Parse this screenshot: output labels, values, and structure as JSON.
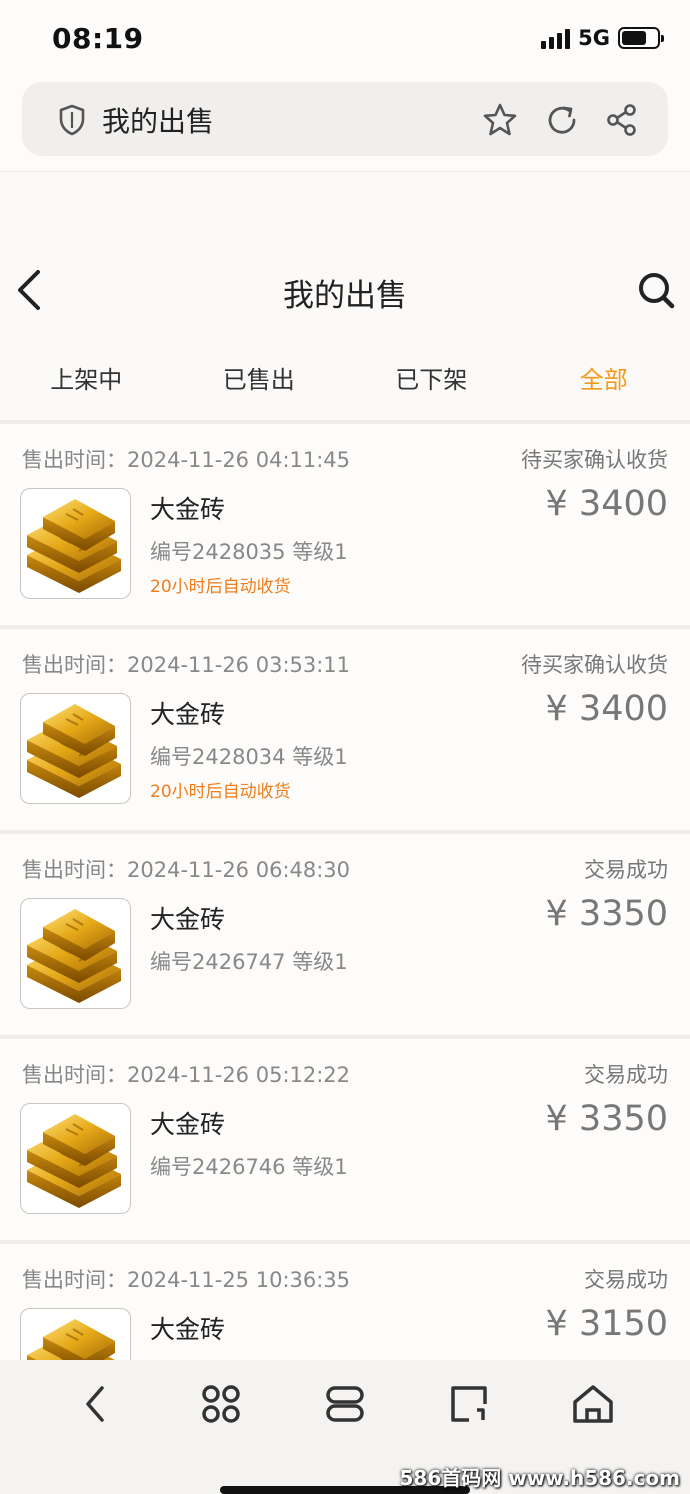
{
  "status_bar": {
    "time": "08:19",
    "network": "5G",
    "battery_level": 0.7
  },
  "browser": {
    "title": "我的出售"
  },
  "nav": {
    "title": "我的出售"
  },
  "tabs": [
    {
      "label": "上架中",
      "active": false
    },
    {
      "label": "已售出",
      "active": false
    },
    {
      "label": "已下架",
      "active": false
    },
    {
      "label": "全部",
      "active": true
    }
  ],
  "orders": [
    {
      "time_label": "售出时间：",
      "time": "2024-11-26 04:11:45",
      "status": "待买家确认收货",
      "name": "大金砖",
      "meta": "编号2428035   等级1",
      "auto_note": "20小时后自动收货",
      "price": "¥ 3400"
    },
    {
      "time_label": "售出时间：",
      "time": "2024-11-26 03:53:11",
      "status": "待买家确认收货",
      "name": "大金砖",
      "meta": "编号2428034   等级1",
      "auto_note": "20小时后自动收货",
      "price": "¥ 3400"
    },
    {
      "time_label": "售出时间：",
      "time": "2024-11-26 06:48:30",
      "status": "交易成功",
      "name": "大金砖",
      "meta": "编号2426747   等级1",
      "auto_note": "",
      "price": "¥ 3350"
    },
    {
      "time_label": "售出时间：",
      "time": "2024-11-26 05:12:22",
      "status": "交易成功",
      "name": "大金砖",
      "meta": "编号2426746   等级1",
      "auto_note": "",
      "price": "¥ 3350"
    },
    {
      "time_label": "售出时间：",
      "time": "2024-11-25 10:36:35",
      "status": "交易成功",
      "name": "大金砖",
      "meta": "",
      "auto_note": "",
      "price": "¥ 3150"
    }
  ],
  "watermark": "586首码网 www.h586.com",
  "colors": {
    "accent": "#f39a1a",
    "auto_note": "#ef7d1a"
  }
}
